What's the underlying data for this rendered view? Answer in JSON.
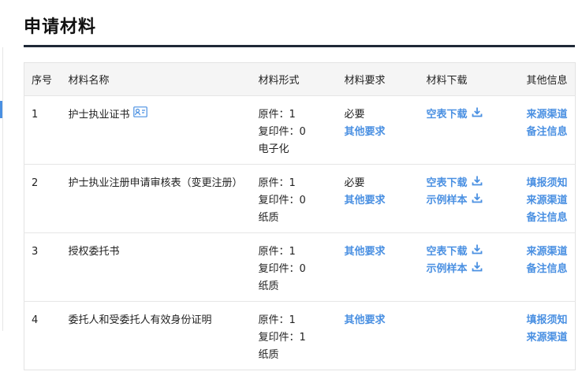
{
  "page": {
    "title": "申请材料"
  },
  "colors": {
    "accent": "#4a90e2",
    "header_bg": "#f5f5f5",
    "title_rule": "#1f2937"
  },
  "table": {
    "headers": [
      "序号",
      "材料名称",
      "材料形式",
      "材料要求",
      "材料下载",
      "其他信息"
    ],
    "rows": [
      {
        "index": "1",
        "name": "护士执业证书",
        "name_icon": "id-card-icon",
        "forms": [
          "原件：1",
          "复印件：0",
          "电子化"
        ],
        "requirements": [
          {
            "text": "必要",
            "link": false
          },
          {
            "text": "其他要求",
            "link": true
          }
        ],
        "downloads": [
          "空表下载"
        ],
        "info": [
          "来源渠道",
          "备注信息"
        ]
      },
      {
        "index": "2",
        "name": "护士执业注册申请审核表（变更注册）",
        "forms": [
          "原件：1",
          "复印件：0",
          "纸质"
        ],
        "requirements": [
          {
            "text": "必要",
            "link": false
          },
          {
            "text": "其他要求",
            "link": true
          }
        ],
        "downloads": [
          "空表下载",
          "示例样本"
        ],
        "info": [
          "填报须知",
          "来源渠道",
          "备注信息"
        ]
      },
      {
        "index": "3",
        "name": "授权委托书",
        "forms": [
          "原件：1",
          "复印件：0",
          "纸质"
        ],
        "requirements": [
          {
            "text": "其他要求",
            "link": true
          }
        ],
        "downloads": [
          "空表下载",
          "示例样本"
        ],
        "info": [
          "来源渠道",
          "备注信息"
        ]
      },
      {
        "index": "4",
        "name": "委托人和受委托人有效身份证明",
        "forms": [
          "原件：1",
          "复印件：1",
          "纸质"
        ],
        "requirements": [
          {
            "text": "其他要求",
            "link": true
          }
        ],
        "downloads": [],
        "info": [
          "填报须知",
          "来源渠道"
        ]
      }
    ]
  }
}
